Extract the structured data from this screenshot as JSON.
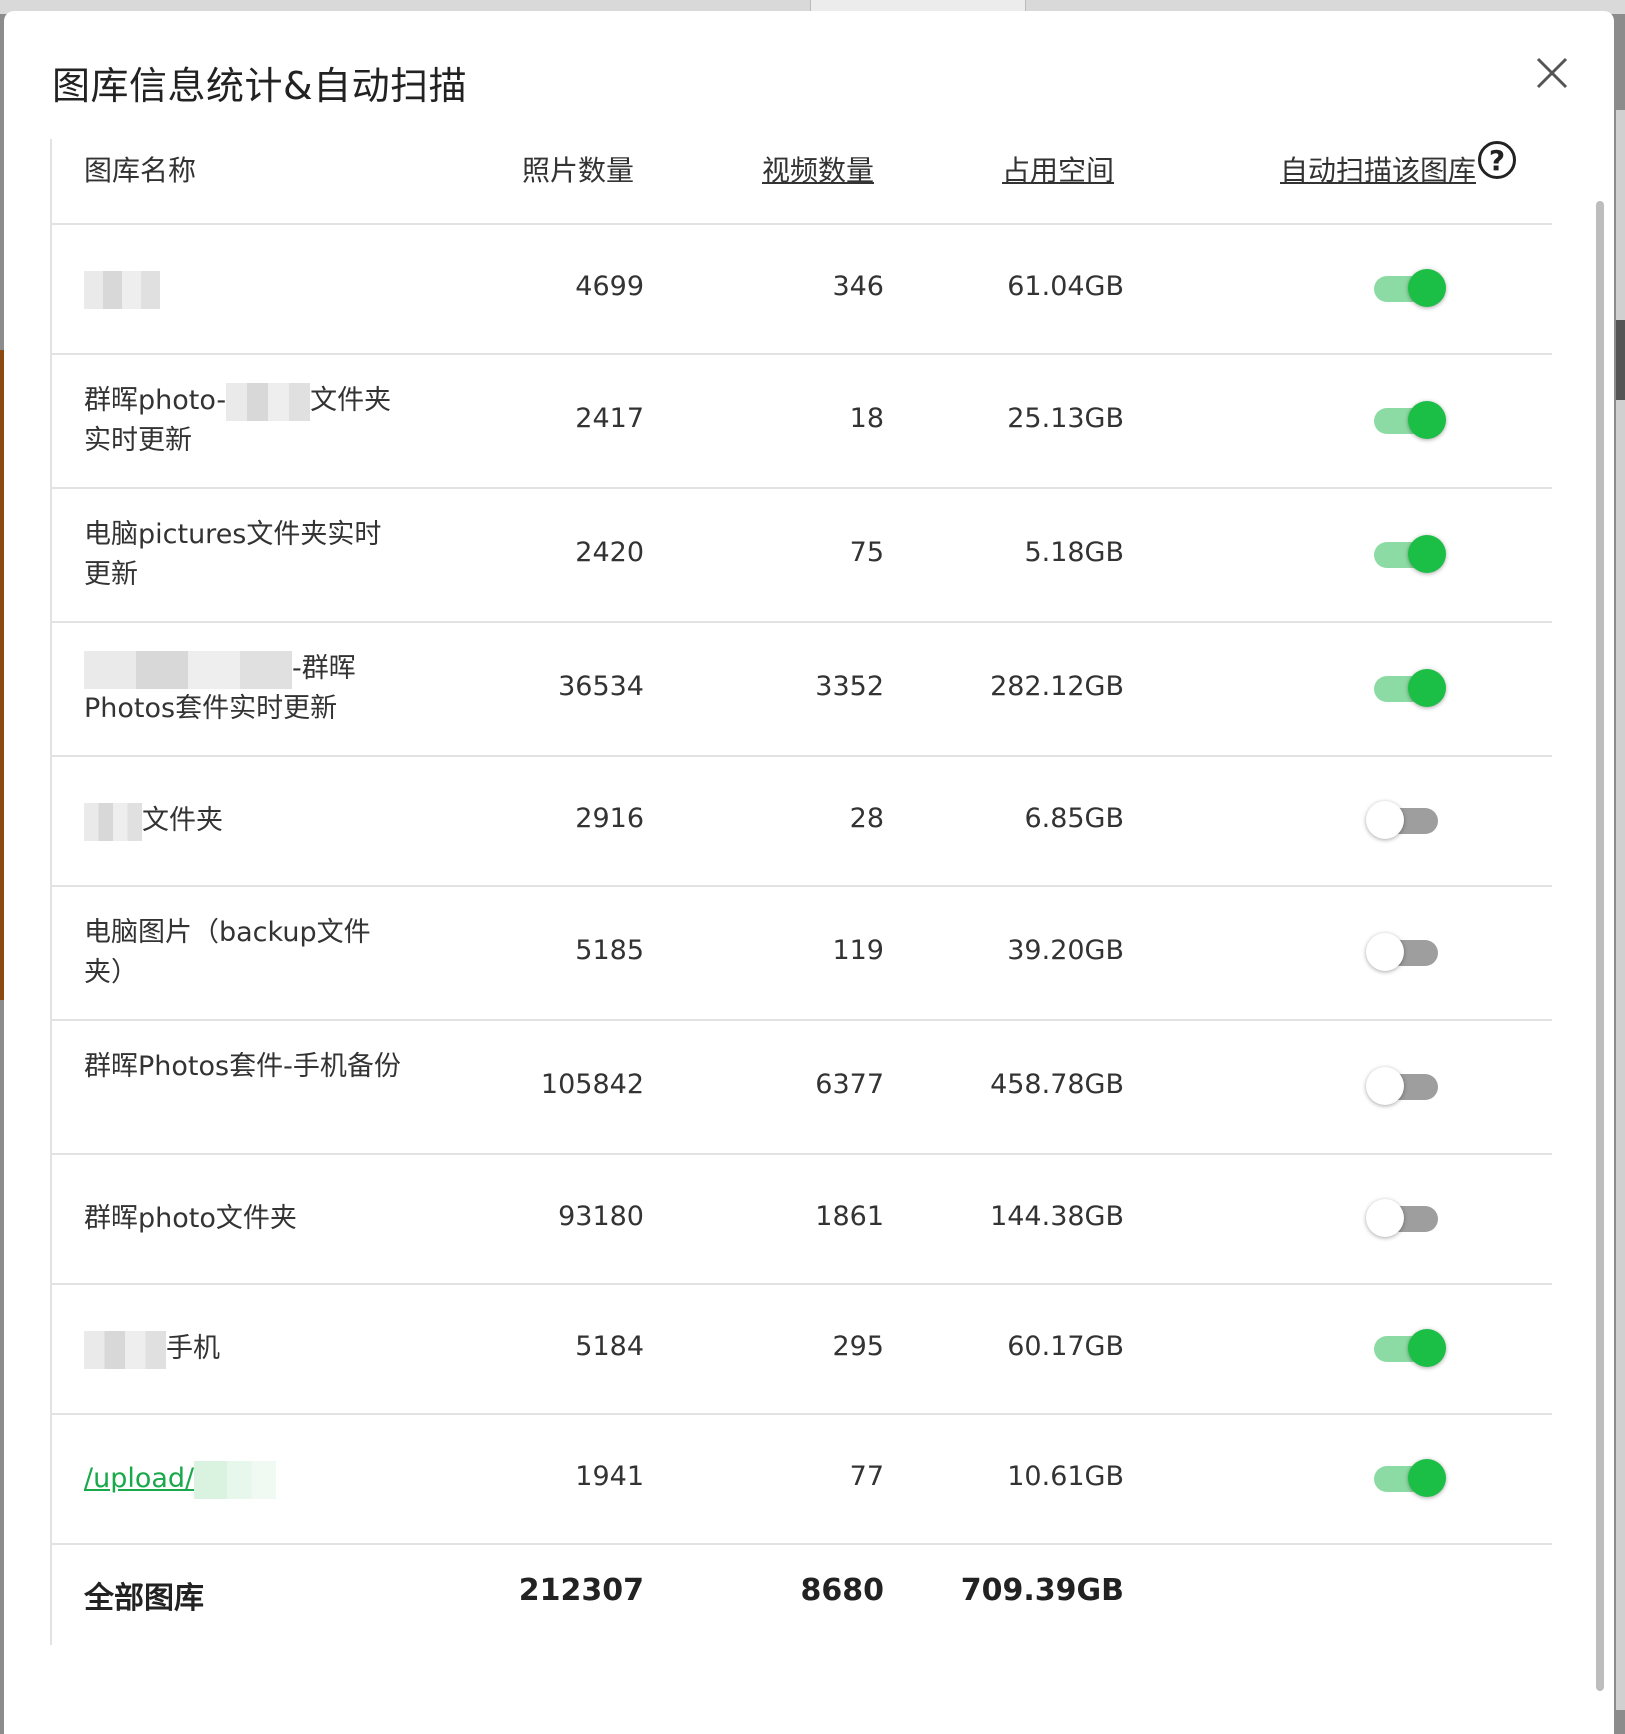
{
  "dialog": {
    "title": "图库信息统计&自动扫描",
    "close_label": "×"
  },
  "table": {
    "headers": {
      "name": "图库名称",
      "photo_count": "照片数量",
      "video_count": "视频数量",
      "size": "占用空间",
      "auto_scan": "自动扫描该图库",
      "help": "?"
    },
    "rows": [
      {
        "name_parts": [
          "",
          ""
        ],
        "photos": "4699",
        "videos": "346",
        "size": "61.04GB",
        "auto_scan": true
      },
      {
        "name_parts": [
          "群晖photo-",
          "文件夹实时更新"
        ],
        "photos": "2417",
        "videos": "18",
        "size": "25.13GB",
        "auto_scan": true
      },
      {
        "name_parts": [
          "电脑pictures文件夹实时更新",
          ""
        ],
        "photos": "2420",
        "videos": "75",
        "size": "5.18GB",
        "auto_scan": true
      },
      {
        "name_parts": [
          "",
          "-群晖Photos套件实时更新"
        ],
        "photos": "36534",
        "videos": "3352",
        "size": "282.12GB",
        "auto_scan": true
      },
      {
        "name_parts": [
          "",
          "文件夹"
        ],
        "photos": "2916",
        "videos": "28",
        "size": "6.85GB",
        "auto_scan": false
      },
      {
        "name_parts": [
          "电脑图片（backup文件夹）",
          ""
        ],
        "photos": "5185",
        "videos": "119",
        "size": "39.20GB",
        "auto_scan": false
      },
      {
        "name_parts": [
          "群晖Photos套件-手机备份",
          ""
        ],
        "photos": "105842",
        "videos": "6377",
        "size": "458.78GB",
        "auto_scan": false
      },
      {
        "name_parts": [
          "群晖photo文件夹",
          ""
        ],
        "photos": "93180",
        "videos": "1861",
        "size": "144.38GB",
        "auto_scan": false
      },
      {
        "name_parts": [
          "",
          "手机"
        ],
        "photos": "5184",
        "videos": "295",
        "size": "60.17GB",
        "auto_scan": true
      },
      {
        "name_parts": [
          "/upload/",
          ""
        ],
        "photos": "1941",
        "videos": "77",
        "size": "10.61GB",
        "auto_scan": true,
        "is_link": true
      }
    ],
    "total": {
      "label": "全部图库",
      "photos": "212307",
      "videos": "8680",
      "size": "709.39GB"
    }
  },
  "colors": {
    "toggle_on": "#1bbf46",
    "toggle_on_track": "#8ddba4",
    "toggle_off_track": "#9e9e9e",
    "link": "#19a84a"
  }
}
